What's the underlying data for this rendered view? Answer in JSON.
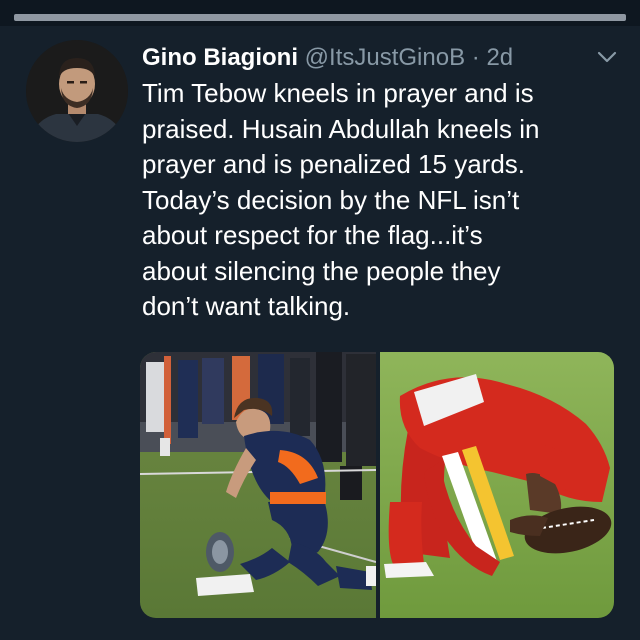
{
  "tweet": {
    "author_name": "Gino Biagioni",
    "handle": "@ItsJustGinoB",
    "separator": "·",
    "time": "2d",
    "text_lines": [
      "Tim Tebow kneels in prayer and is",
      "praised. Husain Abdullah kneels in",
      "prayer and is penalized 15 yards.",
      "Today’s decision by the NFL isn’t",
      "about respect for the flag...it’s",
      "about silencing the people they",
      "don’t want talking."
    ]
  },
  "icons": {
    "more": "chevron-down-icon",
    "avatar": "user-avatar"
  },
  "media": {
    "photos": [
      {
        "subject": "kneeling-player-blue-uniform"
      },
      {
        "subject": "kneeling-player-red-uniform"
      }
    ]
  },
  "colors": {
    "background": "#15202b",
    "text": "#ffffff",
    "secondary": "#8899a6"
  }
}
